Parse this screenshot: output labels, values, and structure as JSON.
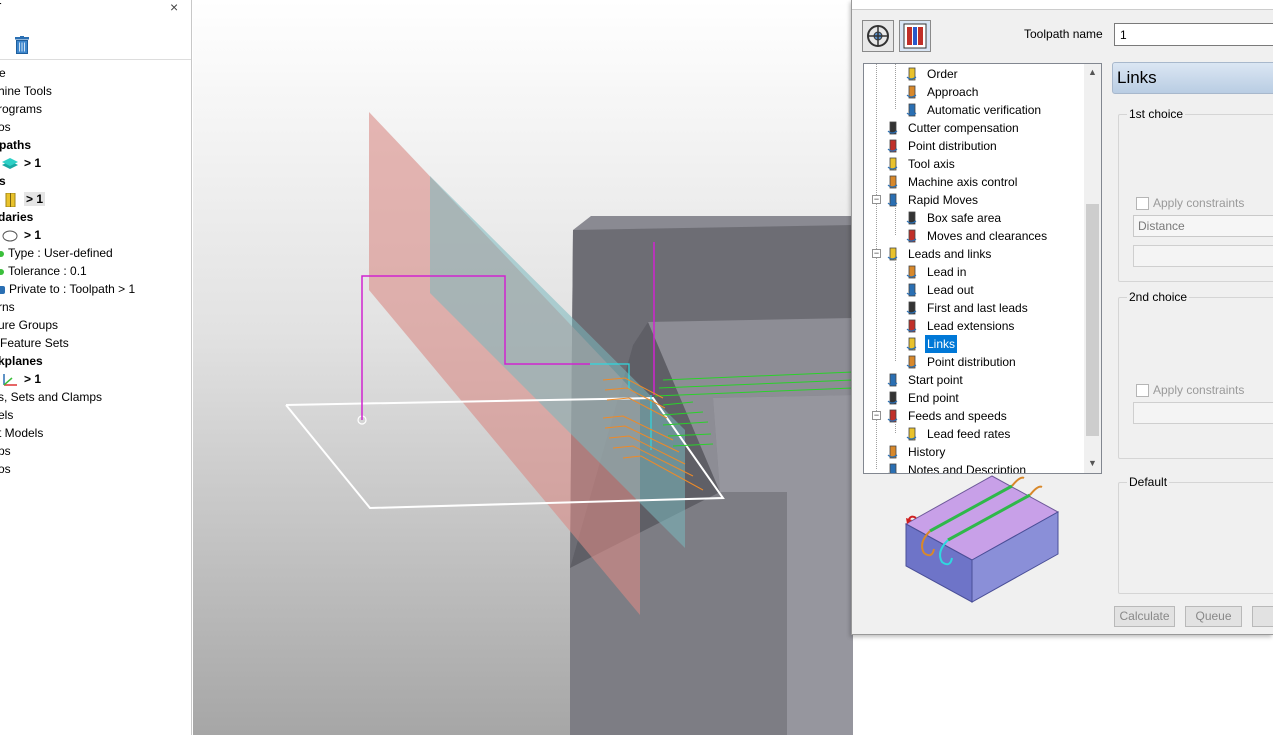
{
  "explorer": {
    "title_fragment": "r",
    "close_glyph": "×",
    "items": [
      {
        "text": "e",
        "bold": false
      },
      {
        "text": "hine Tools",
        "bold": false
      },
      {
        "text": "rograms",
        "bold": false
      },
      {
        "text": "os",
        "bold": false
      },
      {
        "text": "paths",
        "bold": true
      },
      {
        "text": "> 1",
        "bold": true
      },
      {
        "text": "s",
        "bold": true
      },
      {
        "text": "> 1",
        "bold": true
      },
      {
        "text": "daries",
        "bold": true
      },
      {
        "text": "> 1",
        "bold": true
      },
      {
        "text": "Type  :  User-defined",
        "bold": false
      },
      {
        "text": "Tolerance  :  0.1",
        "bold": false
      },
      {
        "text": "Private to : Toolpath > 1",
        "bold": false
      },
      {
        "text": "rns",
        "bold": false
      },
      {
        "text": "ure Groups",
        "bold": false
      },
      {
        "text": "Feature Sets",
        "bold": false
      },
      {
        "text": "kplanes",
        "bold": true
      },
      {
        "text": "> 1",
        "bold": true
      },
      {
        "text": "s, Sets and Clamps",
        "bold": false
      },
      {
        "text": "els",
        "bold": false
      },
      {
        "text": "t Models",
        "bold": false
      },
      {
        "text": "ps",
        "bold": false
      },
      {
        "text": "os",
        "bold": false
      }
    ]
  },
  "dialog": {
    "toolpath_name_label": "Toolpath name",
    "toolpath_name_value": "1",
    "tree": [
      {
        "label": "Order",
        "icon": "order-icon",
        "indent": 2,
        "selected": false
      },
      {
        "label": "Approach",
        "icon": "approach-icon",
        "indent": 2,
        "selected": false
      },
      {
        "label": "Automatic verification",
        "icon": "verification-icon",
        "indent": 2,
        "selected": false
      },
      {
        "label": "Cutter compensation",
        "icon": "cutter-compensation-icon",
        "indent": 1,
        "selected": false
      },
      {
        "label": "Point distribution",
        "icon": "point-distribution-icon",
        "indent": 1,
        "selected": false
      },
      {
        "label": "Tool axis",
        "icon": "tool-axis-icon",
        "indent": 1,
        "selected": false
      },
      {
        "label": "Machine axis control",
        "icon": "machine-axis-icon",
        "indent": 1,
        "selected": false
      },
      {
        "label": "Rapid Moves",
        "icon": "rapid-moves-icon",
        "indent": 1,
        "selected": false,
        "expander": "−"
      },
      {
        "label": "Box safe area",
        "icon": "box-safe-area-icon",
        "indent": 2,
        "selected": false
      },
      {
        "label": "Moves and clearances",
        "icon": "moves-clearances-icon",
        "indent": 2,
        "selected": false
      },
      {
        "label": "Leads and links",
        "icon": "leads-links-icon",
        "indent": 1,
        "selected": false,
        "expander": "−"
      },
      {
        "label": "Lead in",
        "icon": "lead-in-icon",
        "indent": 2,
        "selected": false
      },
      {
        "label": "Lead out",
        "icon": "lead-out-icon",
        "indent": 2,
        "selected": false
      },
      {
        "label": "First and last leads",
        "icon": "first-last-leads-icon",
        "indent": 2,
        "selected": false
      },
      {
        "label": "Lead extensions",
        "icon": "lead-extensions-icon",
        "indent": 2,
        "selected": false
      },
      {
        "label": "Links",
        "icon": "links-icon",
        "indent": 2,
        "selected": true
      },
      {
        "label": "Point distribution",
        "icon": "point-distribution-icon",
        "indent": 2,
        "selected": false
      },
      {
        "label": "Start point",
        "icon": "start-point-icon",
        "indent": 1,
        "selected": false
      },
      {
        "label": "End point",
        "icon": "end-point-icon",
        "indent": 1,
        "selected": false
      },
      {
        "label": "Feeds and speeds",
        "icon": "feeds-speeds-icon",
        "indent": 1,
        "selected": false,
        "expander": "−"
      },
      {
        "label": "Lead feed rates",
        "icon": "lead-feed-rates-icon",
        "indent": 2,
        "selected": false
      },
      {
        "label": "History",
        "icon": "history-icon",
        "indent": 1,
        "selected": false
      },
      {
        "label": "Notes and Description",
        "icon": "notes-icon",
        "indent": 1,
        "selected": false
      }
    ],
    "panel_title": "Links",
    "first_choice": {
      "title": "1st choice",
      "apply_constraints": "Apply constraints",
      "combo_value": "Distance"
    },
    "second_choice": {
      "title": "2nd choice",
      "apply_constraints": "Apply constraints"
    },
    "default_title": "Default",
    "buttons": {
      "calculate": "Calculate",
      "queue": "Queue"
    }
  }
}
